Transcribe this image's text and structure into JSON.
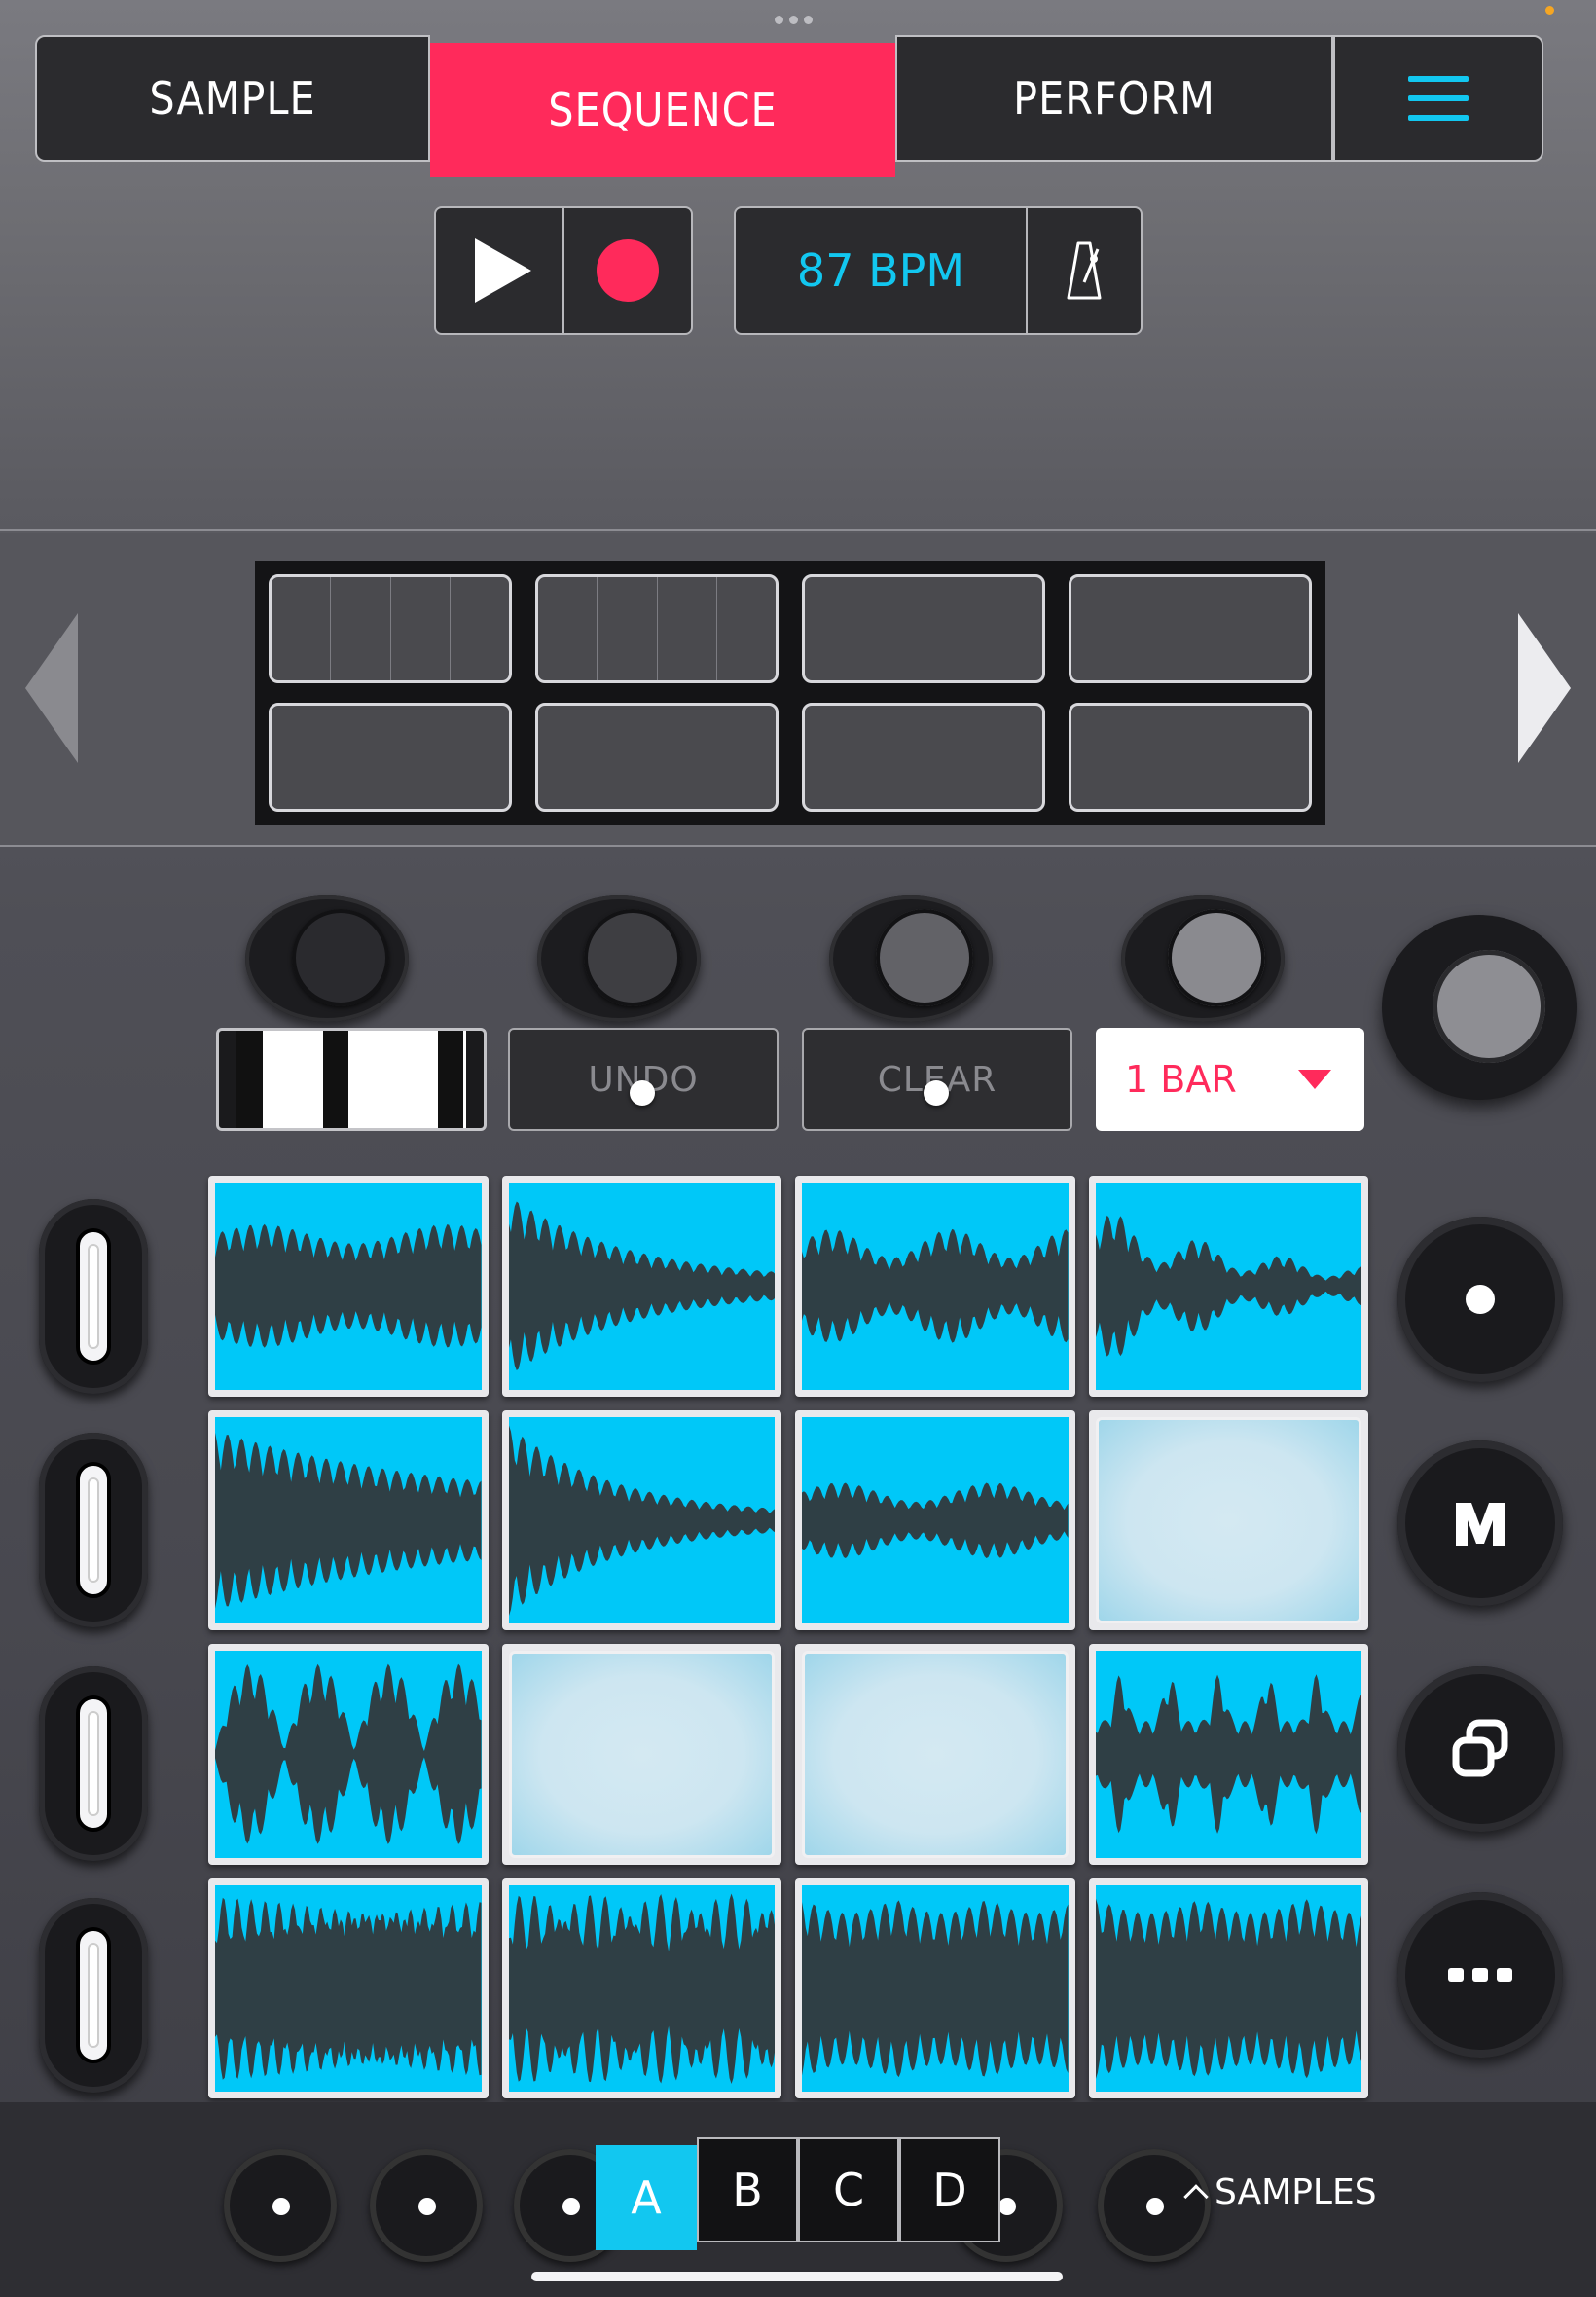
{
  "tabs": {
    "sample": "SAMPLE",
    "sequence": "SEQUENCE",
    "perform": "PERFORM",
    "active": "SEQUENCE"
  },
  "transport": {
    "tempo": "87 BPM"
  },
  "controls": {
    "undo": "UNDO",
    "clear": "CLEAR",
    "bar_length": "1 BAR"
  },
  "pads": [
    {
      "filled": true
    },
    {
      "filled": true
    },
    {
      "filled": true
    },
    {
      "filled": true
    },
    {
      "filled": true
    },
    {
      "filled": true
    },
    {
      "filled": true
    },
    {
      "filled": false
    },
    {
      "filled": true
    },
    {
      "filled": false
    },
    {
      "filled": false
    },
    {
      "filled": true
    },
    {
      "filled": true
    },
    {
      "filled": true
    },
    {
      "filled": true
    },
    {
      "filled": true
    }
  ],
  "banks": {
    "a": "A",
    "b": "B",
    "c": "C",
    "d": "D",
    "active": "A"
  },
  "samples_link": "SAMPLES",
  "colors": {
    "accent": "#ff2a5b",
    "highlight": "#12c7f0",
    "pad": "#00c8f8",
    "waveform": "#2f3f45"
  },
  "icons": {
    "menu": "hamburger-icon",
    "play": "play-icon",
    "record": "record-icon",
    "metronome": "metronome-icon",
    "keyboard": "piano-keys-icon"
  }
}
